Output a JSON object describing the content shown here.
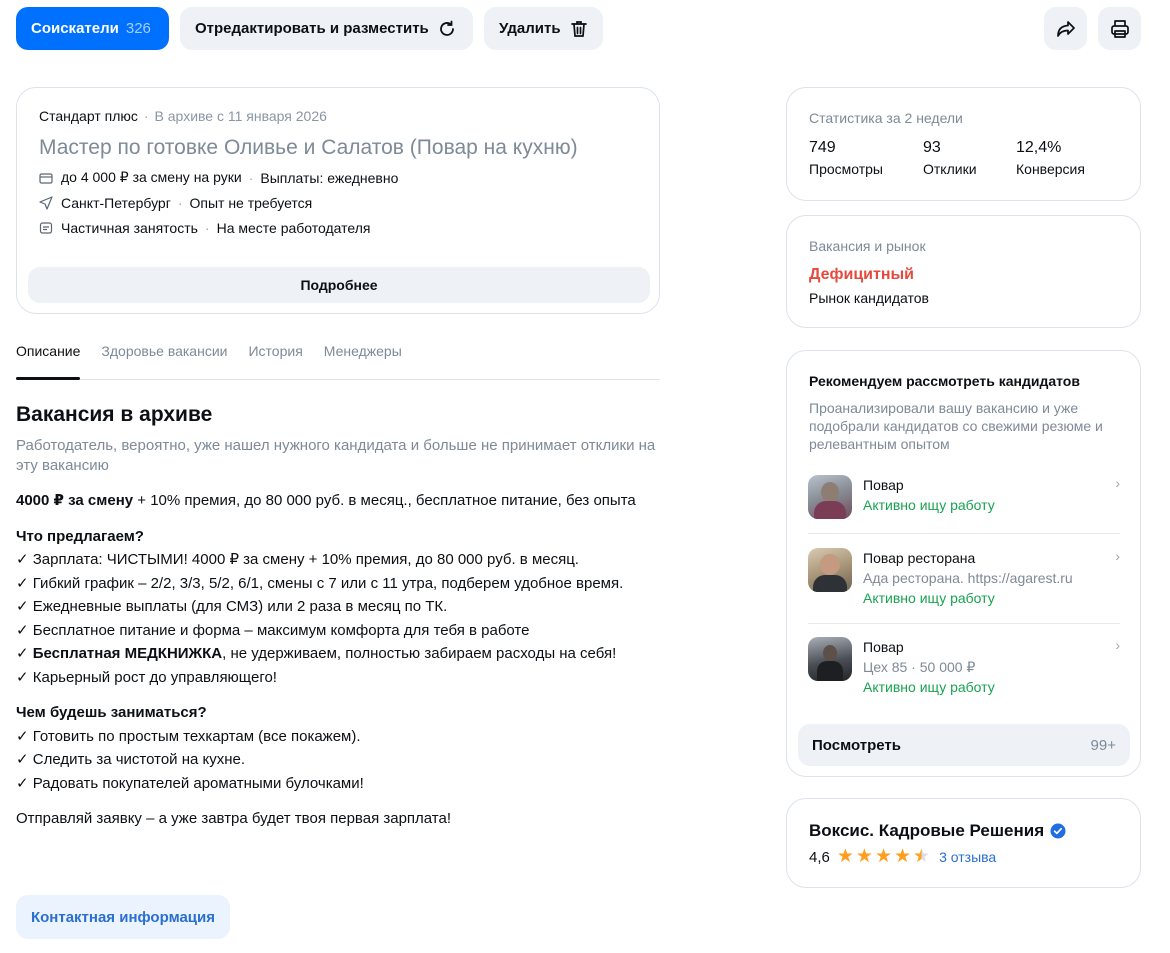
{
  "toolbar": {
    "applicants_label": "Соискатели",
    "applicants_count": "326",
    "edit_publish_label": "Отредактировать и разместить",
    "delete_label": "Удалить",
    "share_icon": "share-icon",
    "print_icon": "print-icon"
  },
  "vacancy": {
    "plan": "Стандарт плюс",
    "archived": "В архиве с 11 января 2026",
    "title": "Мастер по готовке Оливье и Салатов (Повар на кухню)",
    "salary": "до 4 000 ₽ за смену на руки",
    "payouts": "Выплаты: ежедневно",
    "city": "Санкт-Петербург",
    "experience": "Опыт не требуется",
    "employment": "Частичная занятость",
    "workplace": "На месте работодателя",
    "more_label": "Подробнее"
  },
  "tabs": [
    "Описание",
    "Здоровье вакансии",
    "История",
    "Менеджеры"
  ],
  "description": {
    "heading": "Вакансия в архиве",
    "subtitle": "Работодатель, вероятно, уже нашел нужного кандидата и больше не принимает отклики на эту вакансию",
    "lead_bold": "4000 ₽ за смену",
    "lead_rest": " + 10% премия, до 80 000 руб. в месяц., бесплатное питание, без опыта",
    "offer_heading": "Что предлагаем?",
    "offer_items": [
      "✓ Зарплата: ЧИСТЫМИ! 4000 ₽ за смену + 10% премия, до 80 000 руб. в месяц.",
      "✓ Гибкий график – 2/2, 3/3, 5/2, 6/1, смены с 7 или с 11 утра, подберем удобное время.",
      "✓ Ежедневные выплаты (для СМЗ) или 2 раза в месяц по ТК.",
      "✓ Бесплатное питание и форма – максимум комфорта для тебя в работе"
    ],
    "offer_bold_item_bold": "✓ Бесплатная МЕДКНИЖКА",
    "offer_bold_item_rest": ", не удерживаем, полностью забираем расходы на себя!",
    "offer_last": "✓ Карьерный рост до управляющего!",
    "duties_heading": "Чем будешь заниматься?",
    "duties_items": [
      "✓ Готовить по простым техкартам (все покажем).",
      "✓ Следить за чистотой на кухне.",
      "✓ Радовать покупателей ароматными булочками!"
    ],
    "final": "Отправляй заявку – а уже завтра будет твоя первая зарплата!"
  },
  "contact_label": "Контактная информация",
  "stats": {
    "caption": "Статистика за 2 недели",
    "views_value": "749",
    "views_label": "Просмотры",
    "responses_value": "93",
    "responses_label": "Отклики",
    "conversion_value": "12,4%",
    "conversion_label": "Конверсия"
  },
  "market": {
    "caption": "Вакансия и рынок",
    "value": "Дефицитный",
    "subtitle": "Рынок кандидатов",
    "value_color": "#e54b3c"
  },
  "recommend": {
    "title": "Рекомендуем рассмотреть кандидатов",
    "description": "Проанализировали вашу вакансию и уже подобрали кандидатов со свежими резюме и релевантным опытом",
    "candidates": [
      {
        "role": "Повар",
        "extra": "",
        "status": "Активно ищу работу"
      },
      {
        "role": "Повар ресторана",
        "extra": "Ада ресторана. https://agarest.ru",
        "status": "Активно ищу работу"
      },
      {
        "role": "Повар",
        "extra": "Цех 85 · 50 000 ₽",
        "status": "Активно ищу работу"
      }
    ],
    "see_label": "Посмотреть",
    "see_count": "99+"
  },
  "employer": {
    "name": "Воксис. Кадровые Решения",
    "rating": "4,6",
    "stars": 4.5,
    "reviews": "3 отзыва"
  }
}
